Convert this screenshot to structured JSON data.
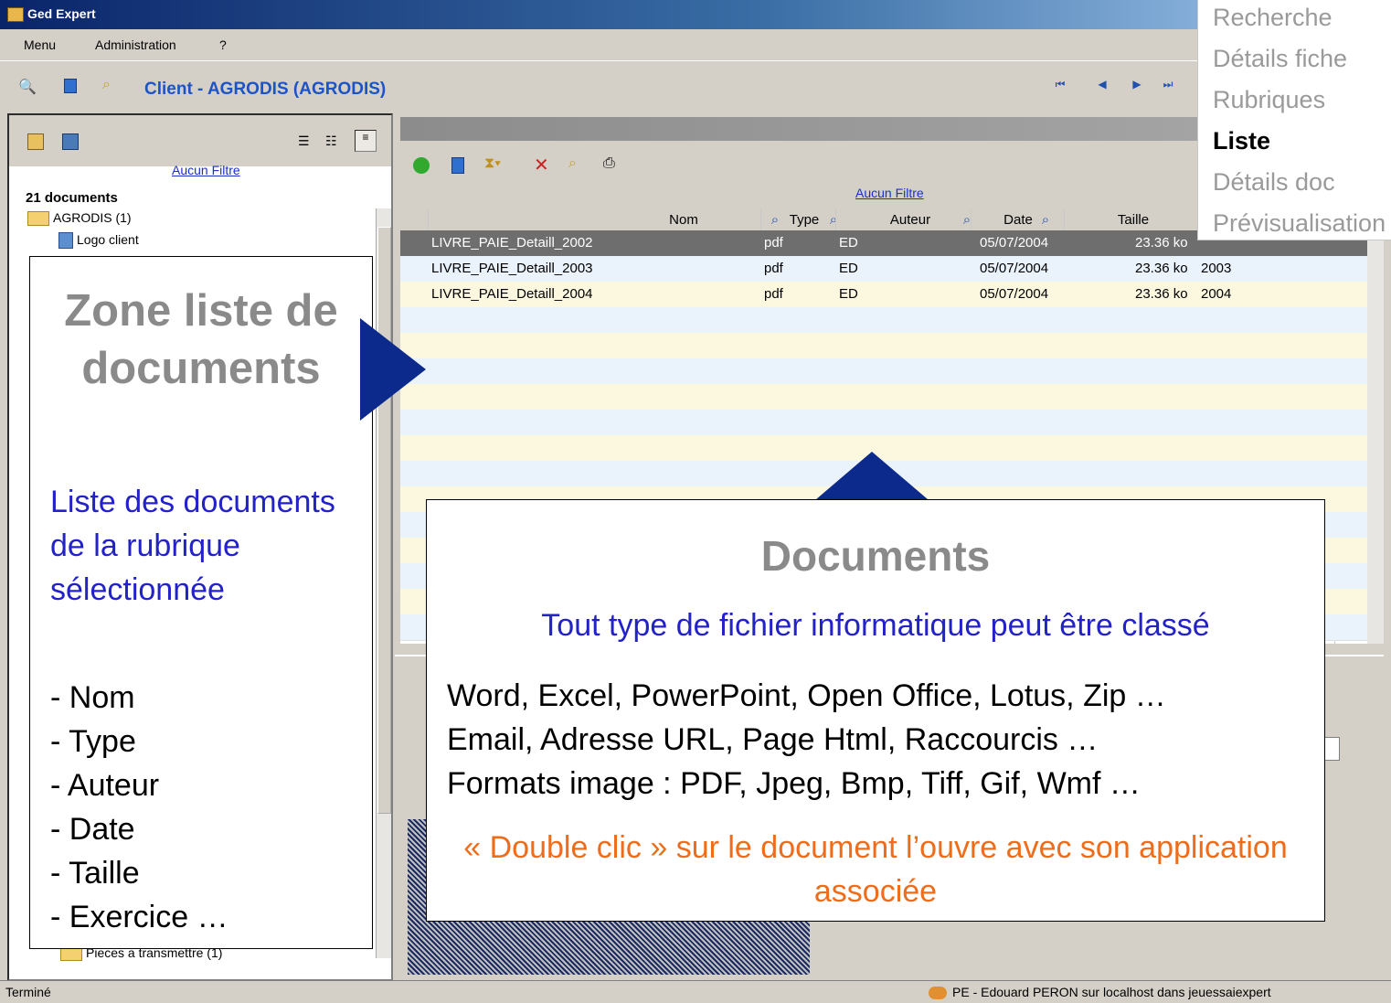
{
  "window": {
    "title": "Ged Expert"
  },
  "menu": {
    "items": [
      "Menu",
      "Administration",
      "?"
    ]
  },
  "record": {
    "title": "Client - AGRODIS (AGRODIS)"
  },
  "rightnav": {
    "items": [
      "Recherche",
      "Détails fiche",
      "Rubriques",
      "Liste",
      "Détails doc",
      "Prévisualisation"
    ],
    "active": "Liste"
  },
  "left": {
    "filter": "Aucun Filtre",
    "count": "21 documents",
    "tree": {
      "root": "AGRODIS (1)",
      "logo": "Logo client",
      "last": "Pieces a transmettre (1)"
    }
  },
  "main": {
    "filter": "Aucun Filtre",
    "columns": [
      "Nom",
      "Type",
      "Auteur",
      "Date",
      "Taille"
    ],
    "rows": [
      {
        "nom": "LIVRE_PAIE_Detaill_2002",
        "type": "pdf",
        "auteur": "ED",
        "date": "05/07/2004",
        "taille": "23.36 ko",
        "exercice": ""
      },
      {
        "nom": "LIVRE_PAIE_Detaill_2003",
        "type": "pdf",
        "auteur": "ED",
        "date": "05/07/2004",
        "taille": "23.36 ko",
        "exercice": "2003"
      },
      {
        "nom": "LIVRE_PAIE_Detaill_2004",
        "type": "pdf",
        "auteur": "ED",
        "date": "05/07/2004",
        "taille": "23.36 ko",
        "exercice": "2004"
      }
    ]
  },
  "callout_left": {
    "title": "Zone liste de documents",
    "desc": "Liste des documents de la rubrique sélectionnée",
    "list": [
      "- Nom",
      "- Type",
      "- Auteur",
      "- Date",
      "- Taille",
      "- Exercice  …"
    ]
  },
  "callout_center": {
    "title": "Documents",
    "subtitle": "Tout type de fichier informatique peut être classé",
    "lines": [
      "Word, Excel, PowerPoint, Open Office, Lotus, Zip …",
      "Email, Adresse URL, Page Html, Raccourcis …",
      "Formats image : PDF, Jpeg, Bmp, Tiff, Gif, Wmf …"
    ],
    "note": "« Double clic » sur le document l’ouvre avec son application associée"
  },
  "status": {
    "left": "Terminé",
    "right": "PE - Edouard PERON sur localhost dans jeuessaiexpert"
  },
  "colors": {
    "accent": "#0b2a8c",
    "callout_blue": "#2222c8",
    "callout_orange": "#ef6d1a",
    "selected_row": "#6e6e6e"
  }
}
